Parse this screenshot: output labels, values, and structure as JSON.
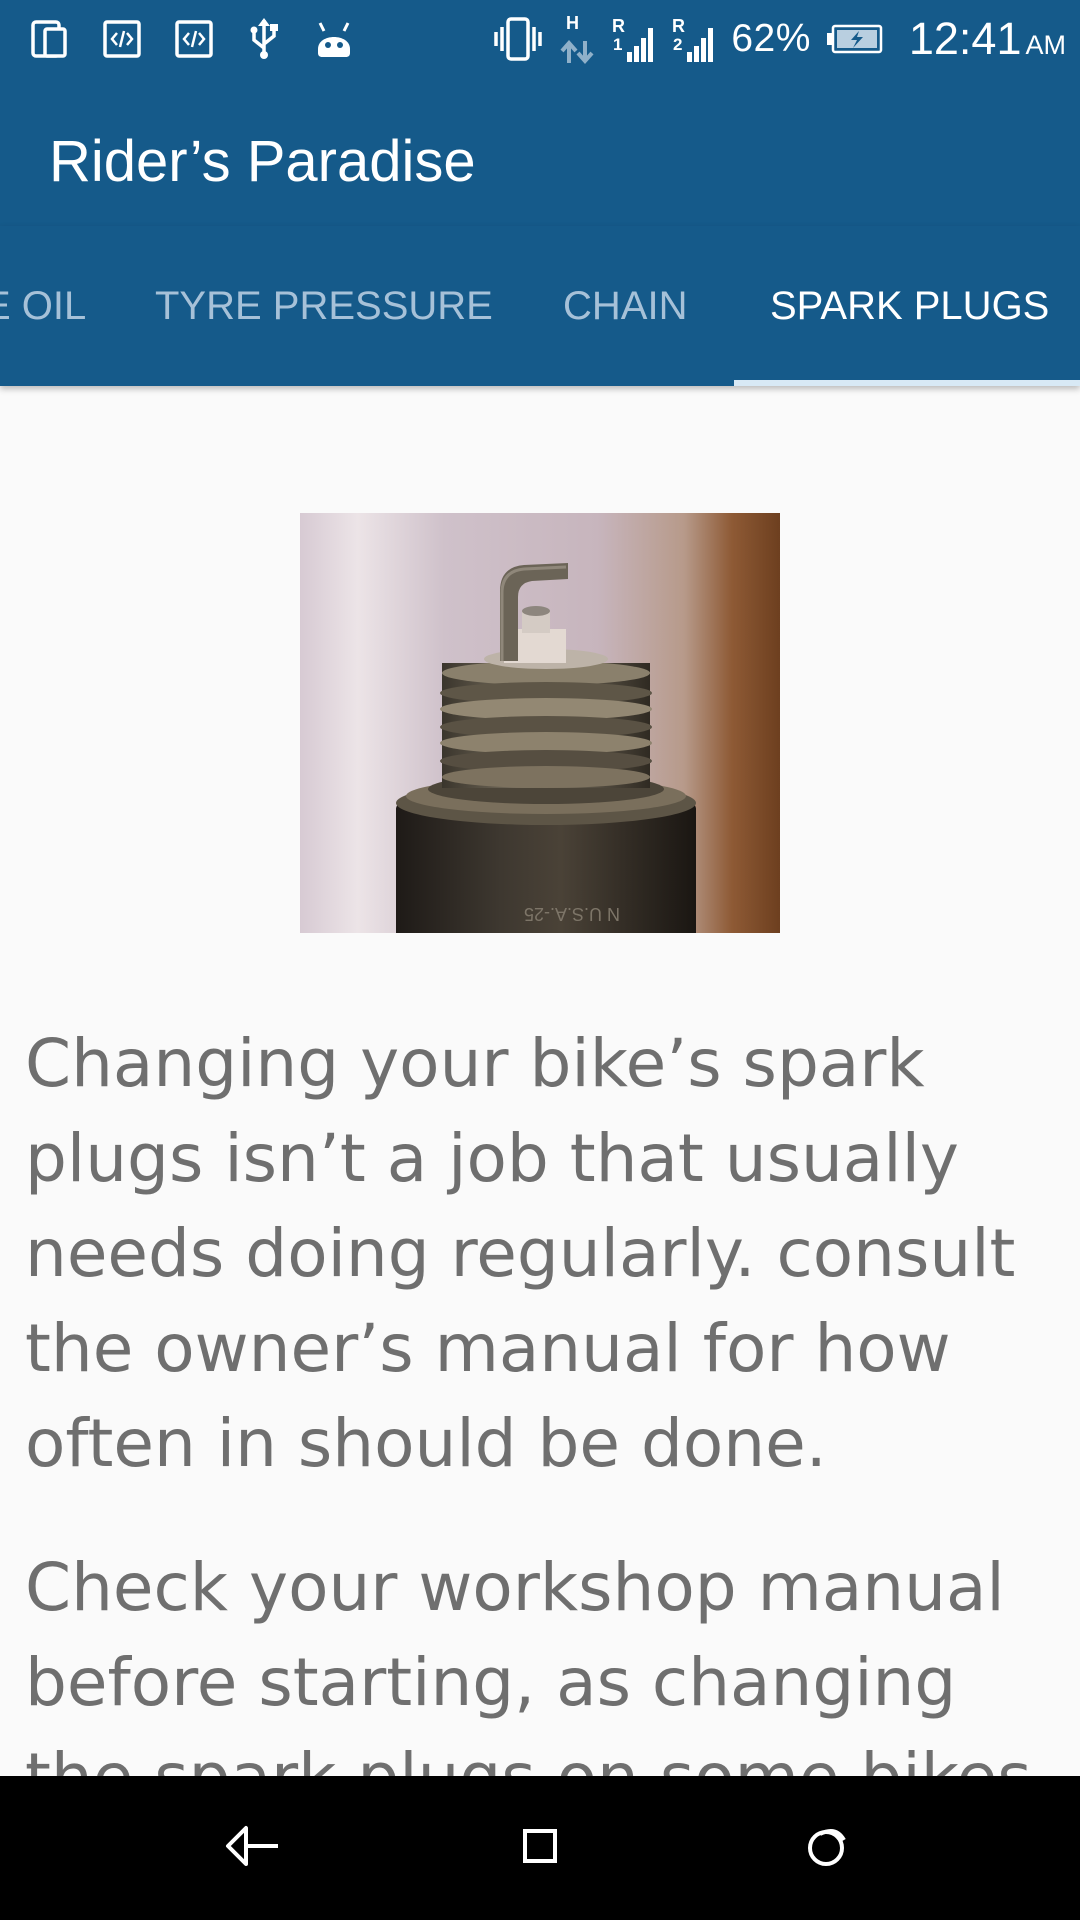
{
  "status_bar": {
    "left_icons": [
      "phone-icon",
      "code-icon",
      "code-icon",
      "usb-icon",
      "android-icon"
    ],
    "right_icons": [
      "vibrate-icon",
      "data-transfer-icon",
      "signal-sim1-icon",
      "signal-sim2-icon",
      "battery-charging-icon"
    ],
    "battery_percent": "62%",
    "time": "12:41",
    "ampm": "AM",
    "colors": {
      "background": "#155a8a",
      "foreground": "#ffffff"
    }
  },
  "app_bar": {
    "title": "Rider’s Paradise",
    "background": "#155a8a"
  },
  "tabs": [
    {
      "label": "E OIL",
      "active": false
    },
    {
      "label": "TYRE PRESSURE",
      "active": false
    },
    {
      "label": "CHAIN",
      "active": false
    },
    {
      "label": "SPARK PLUGS",
      "active": true
    }
  ],
  "content": {
    "image": {
      "subject": "close-up photo of a used spark plug",
      "stamp_text": "N U.S.A.-25"
    },
    "paragraphs": [
      "Changing your bike’s spark plugs isn’t a job that usually needs doing regularly. consult the owner’s manual for how often in should be done.",
      "Check your workshop manual before starting, as changing the spark plugs on some bikes"
    ],
    "text_color": "#6f6f6f"
  },
  "nav_bar": {
    "buttons": [
      "back-icon",
      "home-icon",
      "recents-icon"
    ],
    "background": "#000000"
  }
}
